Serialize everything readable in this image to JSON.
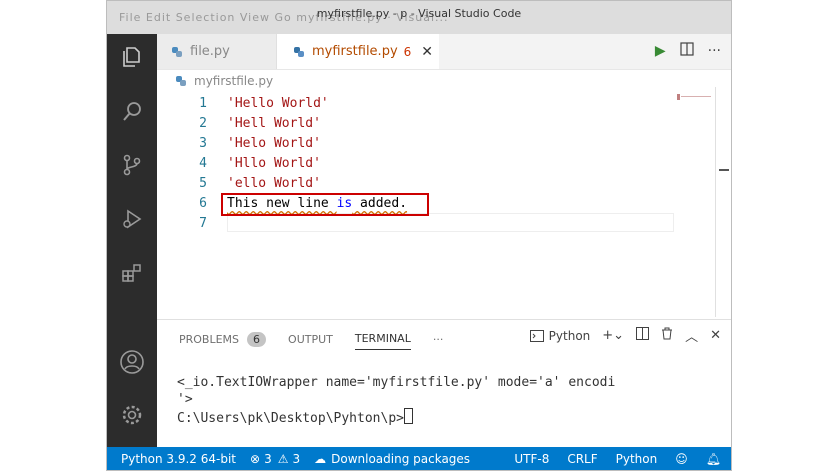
{
  "window": {
    "title": "myfirstfile.py - p - Visual Studio Code",
    "menu": "File  Edit  Selection  View  Go   myfirstfile.py  ·  Visual..."
  },
  "tabs": [
    {
      "label": "file.py"
    },
    {
      "label": "myfirstfile.py",
      "problems": "6"
    }
  ],
  "breadcrumb": {
    "file": "myfirstfile.py"
  },
  "editor": {
    "lines": [
      {
        "num": "1",
        "text": "'Hello World'"
      },
      {
        "num": "2",
        "text": "'Hell World'"
      },
      {
        "num": "3",
        "text": "'Helo World'"
      },
      {
        "num": "4",
        "text": "'Hllo World'"
      },
      {
        "num": "5",
        "text": "'ello World'"
      },
      {
        "num": "6",
        "part1": "This new line ",
        "kw": "is",
        "part2": " added."
      },
      {
        "num": "7",
        "text": ""
      }
    ]
  },
  "panel": {
    "tabs": {
      "problems": "PROBLEMS",
      "problems_count": "6",
      "output": "OUTPUT",
      "terminal": "TERMINAL",
      "more": "···"
    },
    "terminal_profile": "Python",
    "terminal_lines": [
      "<_io.TextIOWrapper name='myfirstfile.py' mode='a' encodi",
      "'>",
      "",
      "C:\\Users\\pk\\Desktop\\Pyhton\\p>"
    ]
  },
  "statusbar": {
    "python": "Python 3.9.2 64-bit",
    "errors": "3",
    "warnings": "3",
    "downloading": "Downloading packages",
    "encoding": "UTF-8",
    "eol": "CRLF",
    "language": "Python"
  },
  "colors": {
    "accent": "#007acc",
    "activity_bar": "#2c2c2c",
    "highlight_box": "#cc0000"
  }
}
